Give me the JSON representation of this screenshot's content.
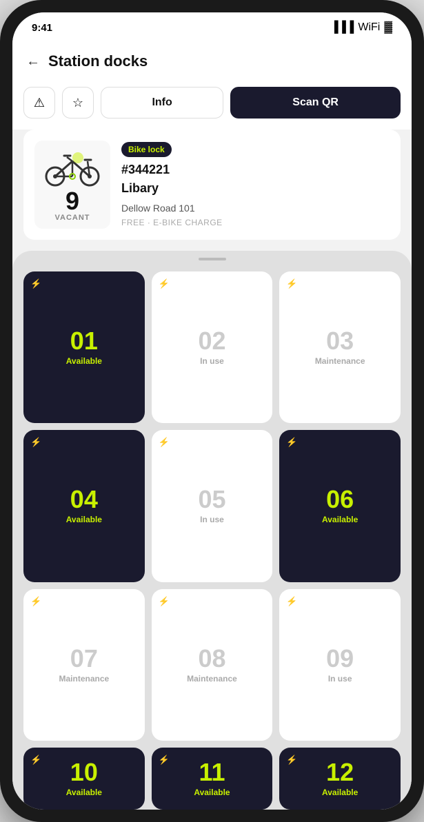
{
  "statusBar": {
    "time": "9:41"
  },
  "header": {
    "back": "←",
    "title": "Station docks"
  },
  "toolbar": {
    "alertIcon": "⚠",
    "starIcon": "☆",
    "infoLabel": "Info",
    "scanLabel": "Scan QR"
  },
  "card": {
    "badge": "Bike lock",
    "id": "#344221",
    "name": "Libary",
    "address": "Dellow Road 101",
    "tags": "FREE · E-BIKE CHARGE",
    "vacant": "9",
    "vacantLabel": "VACANT"
  },
  "docks": [
    {
      "number": "01",
      "status": "Available",
      "type": "available"
    },
    {
      "number": "02",
      "status": "In use",
      "type": "in-use"
    },
    {
      "number": "03",
      "status": "Maintenance",
      "type": "maintenance"
    },
    {
      "number": "04",
      "status": "Available",
      "type": "available"
    },
    {
      "number": "05",
      "status": "In use",
      "type": "in-use"
    },
    {
      "number": "06",
      "status": "Available",
      "type": "available"
    },
    {
      "number": "07",
      "status": "Maintenance",
      "type": "maintenance"
    },
    {
      "number": "08",
      "status": "Maintenance",
      "type": "maintenance"
    },
    {
      "number": "09",
      "status": "In use",
      "type": "in-use"
    },
    {
      "number": "10",
      "status": "Available",
      "type": "available"
    },
    {
      "number": "11",
      "status": "Available",
      "type": "available"
    },
    {
      "number": "12",
      "status": "Available",
      "type": "available"
    }
  ]
}
